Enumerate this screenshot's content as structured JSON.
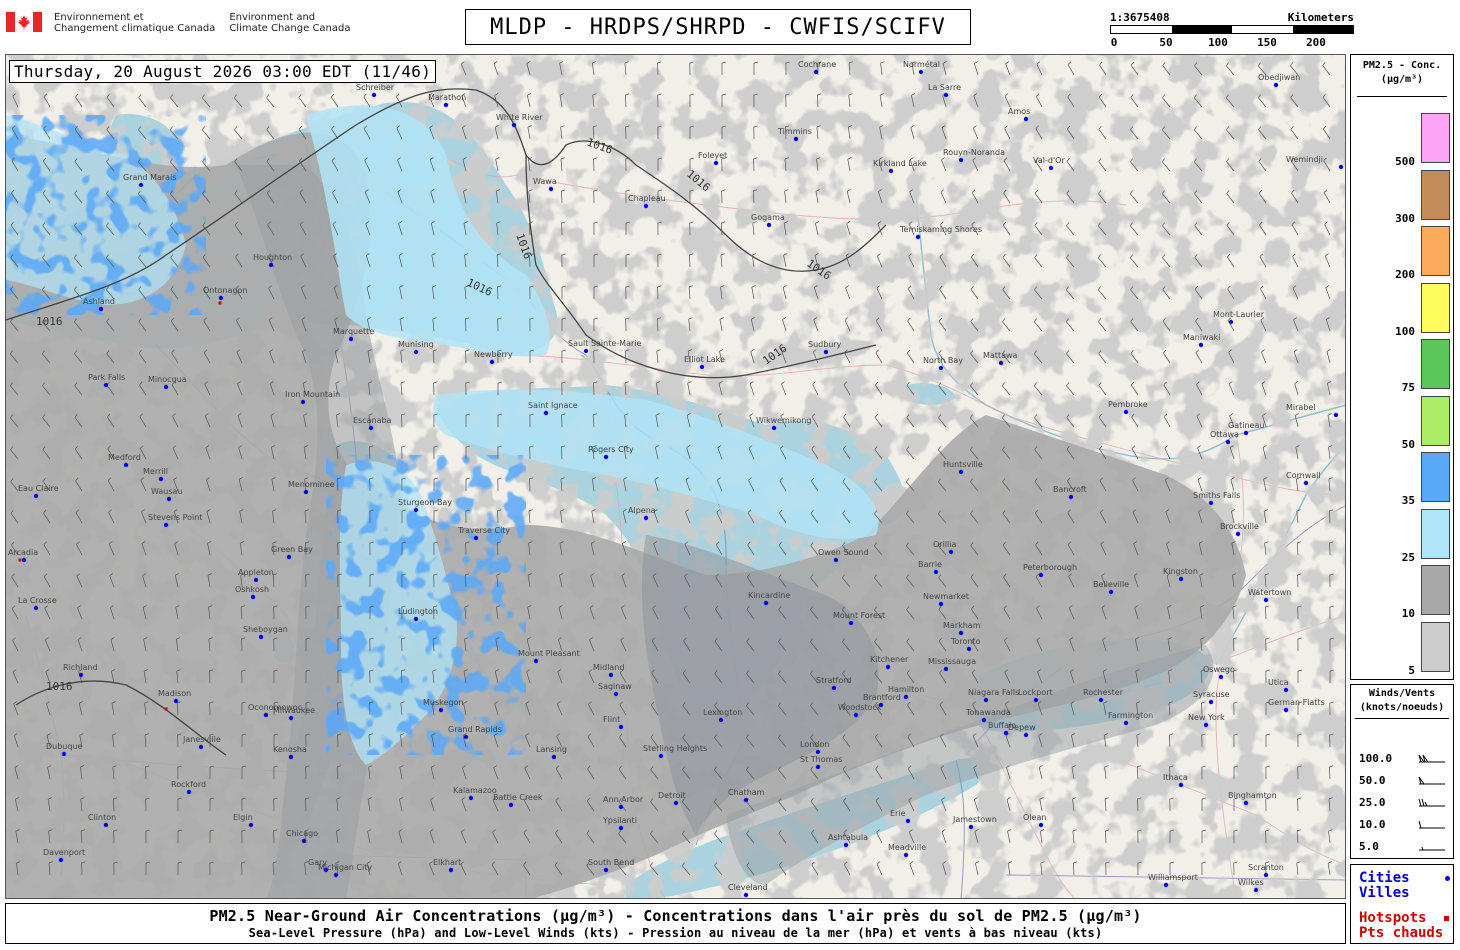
{
  "header": {
    "dept_fr": [
      "Environnement et",
      "Changement climatique Canada"
    ],
    "dept_en": [
      "Environment and",
      "Climate Change Canada"
    ],
    "title": "MLDP - HRDPS/SHRPD - CWFIS/SCIFV",
    "scale_ratio": "1:3675408",
    "scale_unit": "Kilometers",
    "scale_ticks": [
      "0",
      "50",
      "100",
      "150",
      "200"
    ]
  },
  "map": {
    "timestamp": "Thursday, 20 August 2026 03:00 EDT (11/46)",
    "isobar_label": "1016",
    "cities": [
      {
        "name": "Cochrane"
      },
      {
        "name": "Normétal"
      },
      {
        "name": "La Sarre"
      },
      {
        "name": "Amos"
      },
      {
        "name": "Obedjiwan"
      },
      {
        "name": "Schreiber"
      },
      {
        "name": "Marathon"
      },
      {
        "name": "White River"
      },
      {
        "name": "Timmins"
      },
      {
        "name": "Kirkland Lake"
      },
      {
        "name": "Rouyn-Noranda"
      },
      {
        "name": "Val-d'Or"
      },
      {
        "name": "Foleyet"
      },
      {
        "name": "Chapleau"
      },
      {
        "name": "Wawa"
      },
      {
        "name": "Gogama"
      },
      {
        "name": "Temiskaming Shores"
      },
      {
        "name": "Mont-Laurier"
      },
      {
        "name": "Maniwaki"
      },
      {
        "name": "Sault Sainte-Marie"
      },
      {
        "name": "Elliot Lake"
      },
      {
        "name": "Sudbury"
      },
      {
        "name": "North Bay"
      },
      {
        "name": "Mattawa"
      },
      {
        "name": "Marquette"
      },
      {
        "name": "Munising"
      },
      {
        "name": "Newberry"
      },
      {
        "name": "Saint Ignace"
      },
      {
        "name": "Wikwemikong"
      },
      {
        "name": "Pembroke"
      },
      {
        "name": "Ottawa"
      },
      {
        "name": "Escanaba"
      },
      {
        "name": "Rogers City"
      },
      {
        "name": "Huntsville"
      },
      {
        "name": "Bancroft"
      },
      {
        "name": "Smiths Falls"
      },
      {
        "name": "Brockville"
      },
      {
        "name": "Owen Sound"
      },
      {
        "name": "Orillia"
      },
      {
        "name": "Barrie"
      },
      {
        "name": "Peterborough"
      },
      {
        "name": "Belleville"
      },
      {
        "name": "Kingston"
      },
      {
        "name": "Watertown"
      },
      {
        "name": "Newmarket"
      },
      {
        "name": "Markham"
      },
      {
        "name": "Toronto"
      },
      {
        "name": "Mississauga"
      },
      {
        "name": "Kincardine"
      },
      {
        "name": "Mount Forest"
      },
      {
        "name": "Kitchener"
      },
      {
        "name": "Stratford"
      },
      {
        "name": "Hamilton"
      },
      {
        "name": "Brantford"
      },
      {
        "name": "Woodstock"
      },
      {
        "name": "London"
      },
      {
        "name": "St Thomas"
      },
      {
        "name": "Niagara Falls"
      },
      {
        "name": "Tonawanda"
      },
      {
        "name": "Buffalo"
      },
      {
        "name": "Lockport"
      },
      {
        "name": "Rochester"
      },
      {
        "name": "Utica"
      },
      {
        "name": "Syracuse"
      },
      {
        "name": "Oswego"
      },
      {
        "name": "Green Bay"
      },
      {
        "name": "Appleton"
      },
      {
        "name": "Oshkosh"
      },
      {
        "name": "Sheboygan"
      },
      {
        "name": "Milwaukee"
      },
      {
        "name": "Kenosha"
      },
      {
        "name": "Chicago"
      },
      {
        "name": "Gary"
      },
      {
        "name": "Traverse City"
      },
      {
        "name": "Ludington"
      },
      {
        "name": "Mount Pleasant"
      },
      {
        "name": "Midland"
      },
      {
        "name": "Saginaw"
      },
      {
        "name": "Flint"
      },
      {
        "name": "Lansing"
      },
      {
        "name": "Grand Rapids"
      },
      {
        "name": "Muskegon"
      },
      {
        "name": "Kalamazoo"
      },
      {
        "name": "Battle Creek"
      },
      {
        "name": "Ann Arbor"
      },
      {
        "name": "Detroit"
      },
      {
        "name": "Ypsilanti"
      },
      {
        "name": "Chatham"
      },
      {
        "name": "Sterling Heights"
      },
      {
        "name": "Lexington"
      },
      {
        "name": "Erie"
      },
      {
        "name": "Jamestown"
      },
      {
        "name": "Olean"
      },
      {
        "name": "Ithaca"
      },
      {
        "name": "Binghamton"
      },
      {
        "name": "Cleveland"
      },
      {
        "name": "Ashtabula"
      },
      {
        "name": "Meadville"
      },
      {
        "name": "Williamsport"
      },
      {
        "name": "Scranton"
      },
      {
        "name": "Wilkes"
      },
      {
        "name": "Wausau"
      },
      {
        "name": "Medford"
      },
      {
        "name": "Merrill"
      },
      {
        "name": "Stevens Point"
      },
      {
        "name": "Eau Claire"
      },
      {
        "name": "Arcadia"
      },
      {
        "name": "La Crosse"
      },
      {
        "name": "Madison"
      },
      {
        "name": "Janesville"
      },
      {
        "name": "Rockford"
      },
      {
        "name": "Elgin"
      },
      {
        "name": "Dubuque"
      },
      {
        "name": "Davenport"
      },
      {
        "name": "Clinton"
      },
      {
        "name": "Iron Mountain"
      },
      {
        "name": "Menominee"
      },
      {
        "name": "Houghton"
      },
      {
        "name": "Ontonagon"
      },
      {
        "name": "Ashland"
      },
      {
        "name": "Park Falls"
      },
      {
        "name": "Minocqua"
      },
      {
        "name": "Grand Marais"
      },
      {
        "name": "Sturgeon Bay"
      },
      {
        "name": "Alpena"
      },
      {
        "name": "Oconomowoc"
      },
      {
        "name": "Richland"
      },
      {
        "name": "South Bend"
      },
      {
        "name": "Elkhart"
      },
      {
        "name": "Michigan City"
      },
      {
        "name": "Farmington"
      },
      {
        "name": "German Flatts"
      },
      {
        "name": "New York"
      },
      {
        "name": "Depew"
      },
      {
        "name": "Gatineau"
      },
      {
        "name": "Mirabel"
      },
      {
        "name": "Cornwall"
      },
      {
        "name": "Wemindji"
      }
    ]
  },
  "legend": {
    "title": [
      "PM2.5 - Conc.",
      "(µg/m³)"
    ],
    "levels": [
      {
        "label": "500",
        "color": "#fda3f8"
      },
      {
        "label": "300",
        "color": "#c38c5d"
      },
      {
        "label": "200",
        "color": "#fcaa5c"
      },
      {
        "label": "100",
        "color": "#fdfd5e"
      },
      {
        "label": "75",
        "color": "#5bc65b"
      },
      {
        "label": "50",
        "color": "#adec67"
      },
      {
        "label": "35",
        "color": "#5aa8f8"
      },
      {
        "label": "25",
        "color": "#b0e4f8"
      },
      {
        "label": "10",
        "color": "#a8a8a8"
      },
      {
        "label": "5",
        "color": "#cdcdcd"
      }
    ]
  },
  "winds": {
    "title": [
      "Winds/Vents",
      "(knots/noeuds)"
    ],
    "rows": [
      {
        "label": "100.0"
      },
      {
        "label": "50.0"
      },
      {
        "label": "25.0"
      },
      {
        "label": "10.0"
      },
      {
        "label": "5.0"
      }
    ]
  },
  "cities_panel": {
    "cities": [
      "Cities",
      "Villes"
    ],
    "hotspots": [
      "Hotspots",
      "Pts chauds"
    ],
    "city_color": "#0000ee",
    "hotspot_color": "#cc0000"
  },
  "caption": {
    "line1": "PM2.5 Near-Ground Air Concentrations (µg/m³) - Concentrations dans l'air près du sol de PM2.5 (µg/m³)",
    "line2": "Sea-Level Pressure (hPa) and Low-Level Winds (kts) - Pression au niveau de la mer (hPa) et vents à bas niveau (kts)"
  },
  "colors": {
    "land": "#f1efe8",
    "water_base": "#aad3df",
    "plume_light": "#cdcdcd",
    "plume_dark": "#a8a8a8",
    "plume_blue": "#b0e4f8",
    "plume_mid_blue": "#5aa8f8"
  }
}
